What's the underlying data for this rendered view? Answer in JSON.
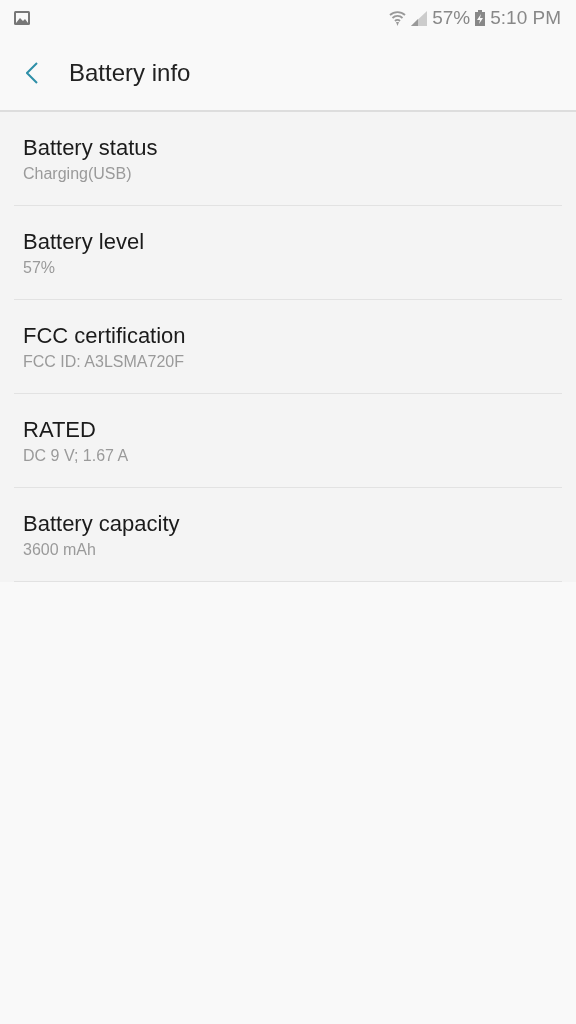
{
  "status_bar": {
    "battery": "57%",
    "time": "5:10 PM"
  },
  "header": {
    "title": "Battery info"
  },
  "items": [
    {
      "title": "Battery status",
      "value": "Charging(USB)"
    },
    {
      "title": "Battery level",
      "value": "57%"
    },
    {
      "title": "FCC certification",
      "value": "FCC ID: A3LSMA720F"
    },
    {
      "title": "RATED",
      "value": "DC 9 V; 1.67 A"
    },
    {
      "title": "Battery capacity",
      "value": "3600 mAh"
    }
  ]
}
